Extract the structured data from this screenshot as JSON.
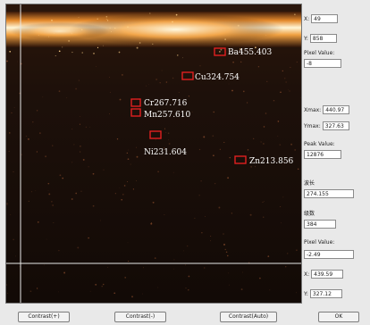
{
  "spectrum": {
    "markers": [
      {
        "label": "Ba455.403"
      },
      {
        "label": "Cu324.754"
      },
      {
        "label": "Cr267.716"
      },
      {
        "label": "Mn257.610"
      },
      {
        "label": "Ni231.604"
      },
      {
        "label": "Zn213.856"
      }
    ]
  },
  "panel": {
    "x_label": "X:",
    "x_value": "49",
    "y_label": "Y:",
    "y_value": "858",
    "pixel_value_label": "Pixel Value:",
    "pixel_value": "-8",
    "xmax_label": "Xmax:",
    "xmax_value": "440.97",
    "ymax_label": "Ymax:",
    "ymax_value": "327.63",
    "peak_value_label": "Peak Value:",
    "peak_value": "12876",
    "wavelength_label": "波长",
    "wavelength_value": "274.155",
    "order_label": "级数",
    "order_value": "384",
    "pixel_value2_label": "Pixel Value:",
    "pixel_value2": "-2.49",
    "x2_label": "X:",
    "x2_value": "439.59",
    "y2_label": "Y:",
    "y2_value": "327.12"
  },
  "buttons": {
    "contrast_plus": "Contrast(+)",
    "contrast_minus": "Contrast(-)",
    "contrast_auto": "Contrast(Auto)",
    "ok": "OK"
  }
}
